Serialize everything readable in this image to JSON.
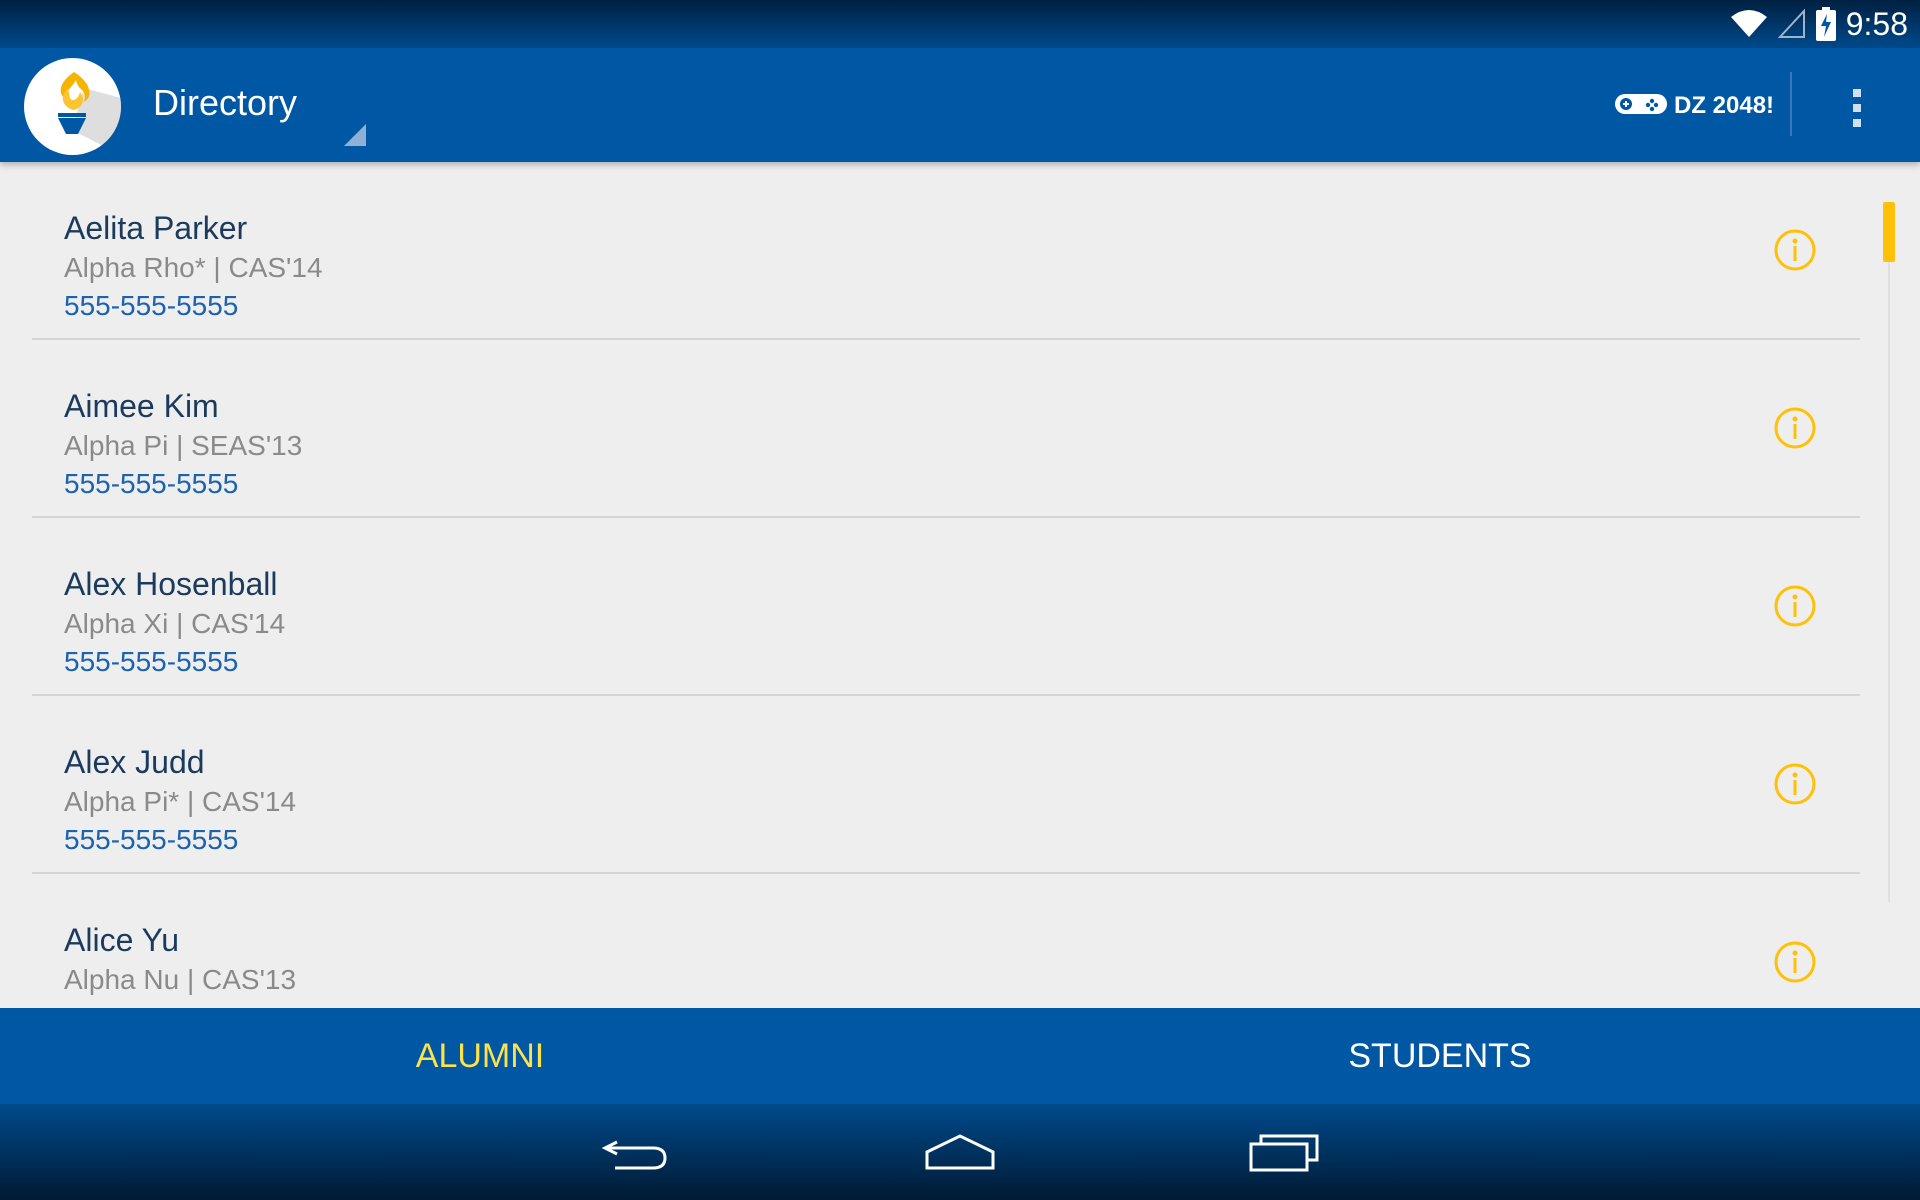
{
  "status_bar": {
    "time": "9:58",
    "icons": [
      "wifi-icon",
      "cell-signal-icon",
      "battery-charging-icon"
    ]
  },
  "action_bar": {
    "title": "Directory",
    "logo_icon": "torch-icon",
    "game_link": {
      "icon": "gamepad-icon",
      "label": "DZ 2048!"
    },
    "overflow_icon": "overflow-menu-icon"
  },
  "contacts": [
    {
      "name": "Aelita Parker",
      "chapter_class": "Alpha Rho* | CAS'14",
      "phone": "555-555-5555"
    },
    {
      "name": "Aimee Kim",
      "chapter_class": "Alpha Pi | SEAS'13",
      "phone": "555-555-5555"
    },
    {
      "name": "Alex Hosenball",
      "chapter_class": "Alpha Xi | CAS'14",
      "phone": "555-555-5555"
    },
    {
      "name": "Alex Judd",
      "chapter_class": "Alpha Pi* | CAS'14",
      "phone": "555-555-5555"
    },
    {
      "name": "Alice Yu",
      "chapter_class": "Alpha Nu | CAS'13",
      "phone": ""
    }
  ],
  "tabs": [
    {
      "label": "ALUMNI",
      "active": true
    },
    {
      "label": "STUDENTS",
      "active": false
    }
  ],
  "nav_bar": [
    "back-icon",
    "home-icon",
    "recents-icon"
  ],
  "colors": {
    "primary": "#0057a3",
    "accent": "#ffc107",
    "active_tab": "#fde24b",
    "phone_link": "#1b63b0"
  }
}
